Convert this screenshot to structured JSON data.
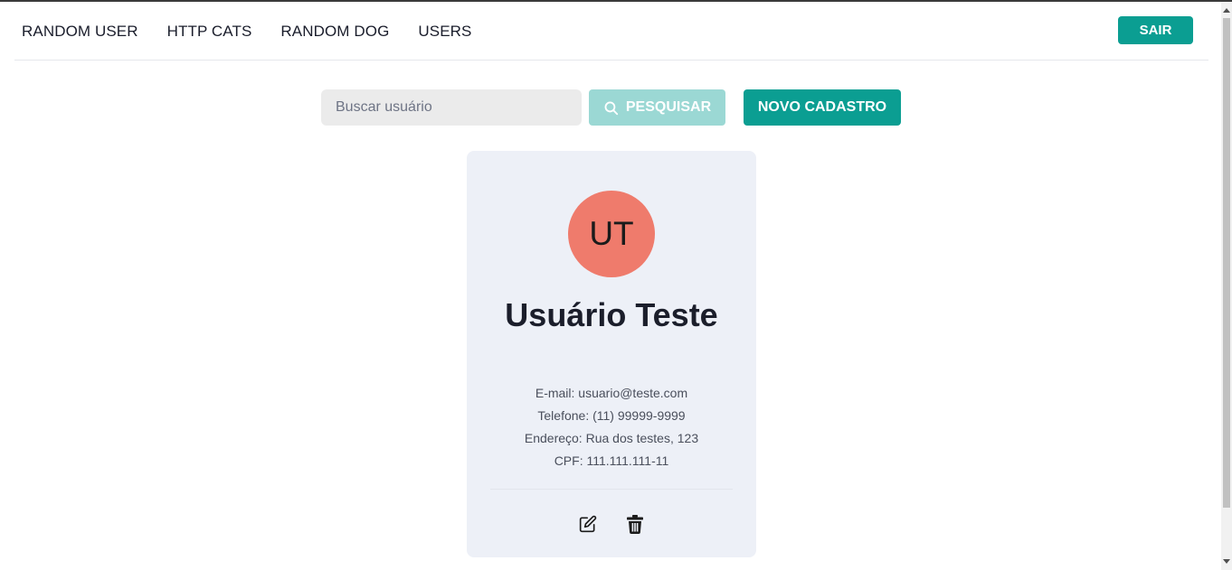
{
  "navbar": {
    "links": [
      {
        "label": "RANDOM USER"
      },
      {
        "label": "HTTP CATS"
      },
      {
        "label": "RANDOM DOG"
      },
      {
        "label": "USERS"
      }
    ],
    "logout_label": "SAIR"
  },
  "search": {
    "placeholder": "Buscar usuário",
    "value": "",
    "button_label": "PESQUISAR",
    "button_icon": "search-icon"
  },
  "new_button_label": "NOVO CADASTRO",
  "user_card": {
    "initials": "UT",
    "name": "Usuário Teste",
    "email": "E-mail: usuario@teste.com",
    "phone": "Telefone: (11) 99999-9999",
    "address": "Endereço: Rua dos testes, 123",
    "cpf": "CPF: 111.111.111-11",
    "actions": [
      {
        "icon": "edit-icon"
      },
      {
        "icon": "trash-icon"
      }
    ]
  },
  "colors": {
    "accent": "#0b9e92",
    "accent_disabled": "#9bd8d4",
    "avatar_bg": "#ef7b6c",
    "card_bg": "#edf0f7",
    "input_bg": "#ebebeb"
  }
}
